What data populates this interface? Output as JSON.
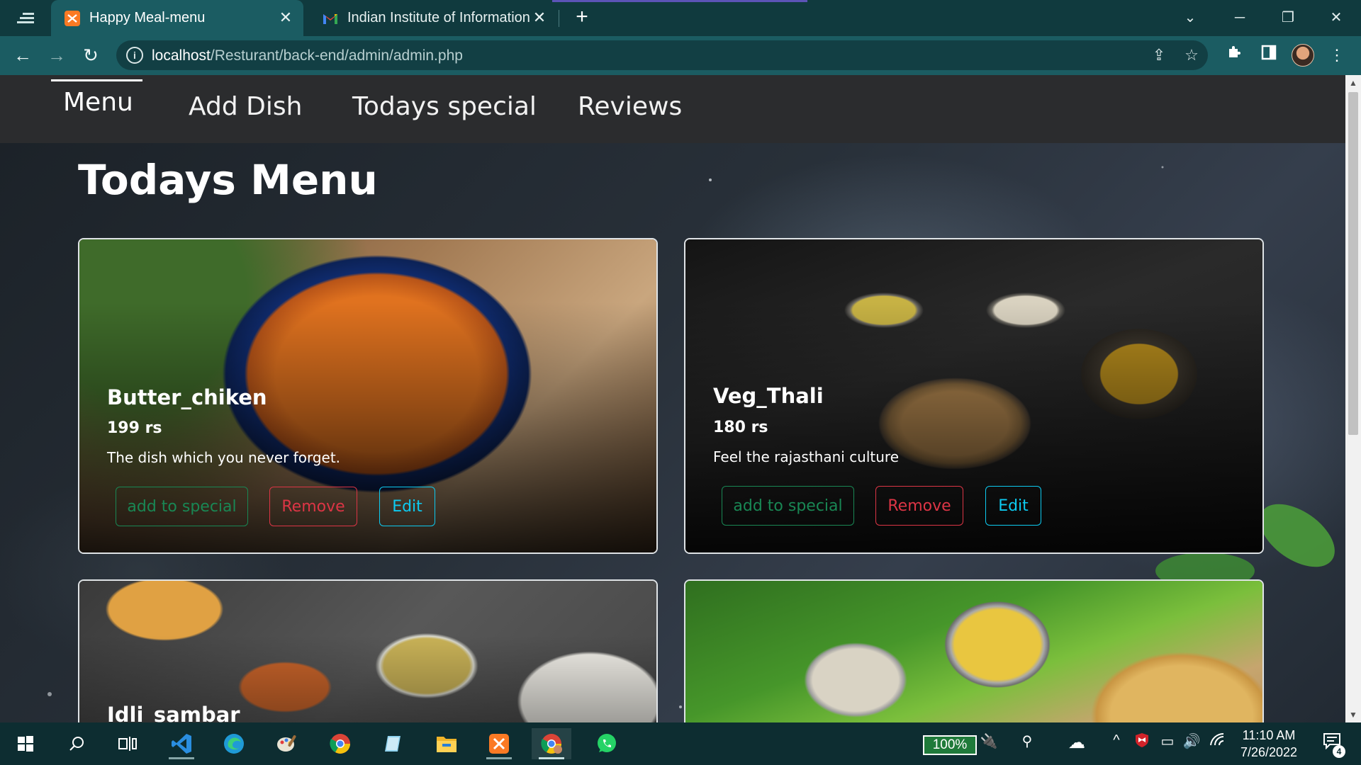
{
  "browser": {
    "tabs": [
      {
        "title": "Happy Meal-menu",
        "active": true,
        "favicon": "xampp-icon"
      },
      {
        "title": "Indian Institute of Information Te",
        "active": false,
        "favicon": "gmail-icon"
      }
    ],
    "url_host": "localhost",
    "url_path": "/Resturant/back-end/admin/admin.php",
    "accent_color": "#1b5c62"
  },
  "nav": {
    "items": [
      {
        "label": "Menu",
        "active": true
      },
      {
        "label": "Add Dish",
        "active": false
      },
      {
        "label": "Todays special",
        "active": false
      },
      {
        "label": "Reviews",
        "active": false
      }
    ]
  },
  "page": {
    "title": "Todays Menu"
  },
  "dishes": [
    {
      "name": "Butter_chiken",
      "price": "199 rs",
      "description": "The dish which you never forget.",
      "buttons": {
        "special": "add to special",
        "remove": "Remove",
        "edit": "Edit"
      }
    },
    {
      "name": "Veg_Thali",
      "price": "180 rs",
      "description": "Feel the rajasthani culture",
      "buttons": {
        "special": "add to special",
        "remove": "Remove",
        "edit": "Edit"
      }
    },
    {
      "name": "Idli_sambar"
    },
    {
      "name": ""
    }
  ],
  "button_colors": {
    "special": "#198754",
    "remove": "#dc3545",
    "edit": "#0dcaf0"
  },
  "taskbar": {
    "battery": "100%",
    "time": "11:10 AM",
    "date": "7/26/2022",
    "notifications": "4",
    "apps": [
      "windows-icon",
      "search-icon",
      "task-view-icon",
      "vscode-icon",
      "edge-icon",
      "paint-icon",
      "chrome-icon",
      "notepad-icon",
      "file-explorer-icon",
      "xampp-icon",
      "chrome-profile-icon",
      "whatsapp-icon"
    ]
  }
}
